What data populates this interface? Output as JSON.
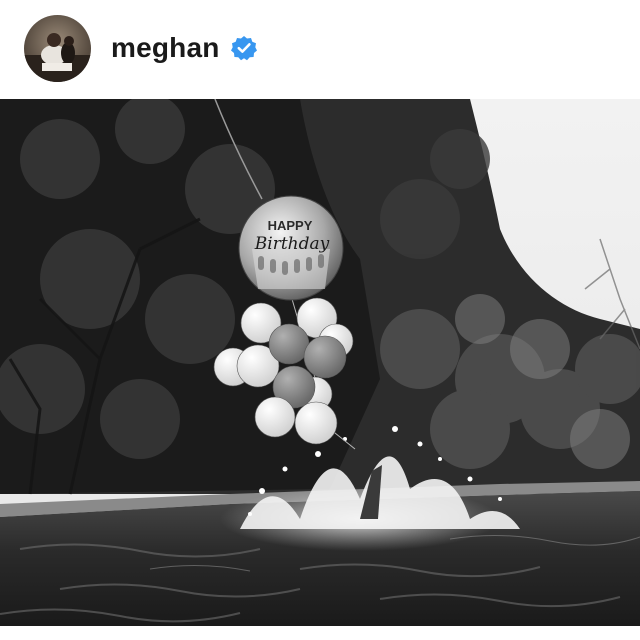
{
  "post": {
    "username": "meghan",
    "verified": true,
    "badge_color": "#3897f0",
    "avatar_icon": "profile-photo",
    "image": {
      "balloon_text_line1": "HAPPY",
      "balloon_text_line2": "Birthday",
      "style": "black-and-white"
    }
  }
}
